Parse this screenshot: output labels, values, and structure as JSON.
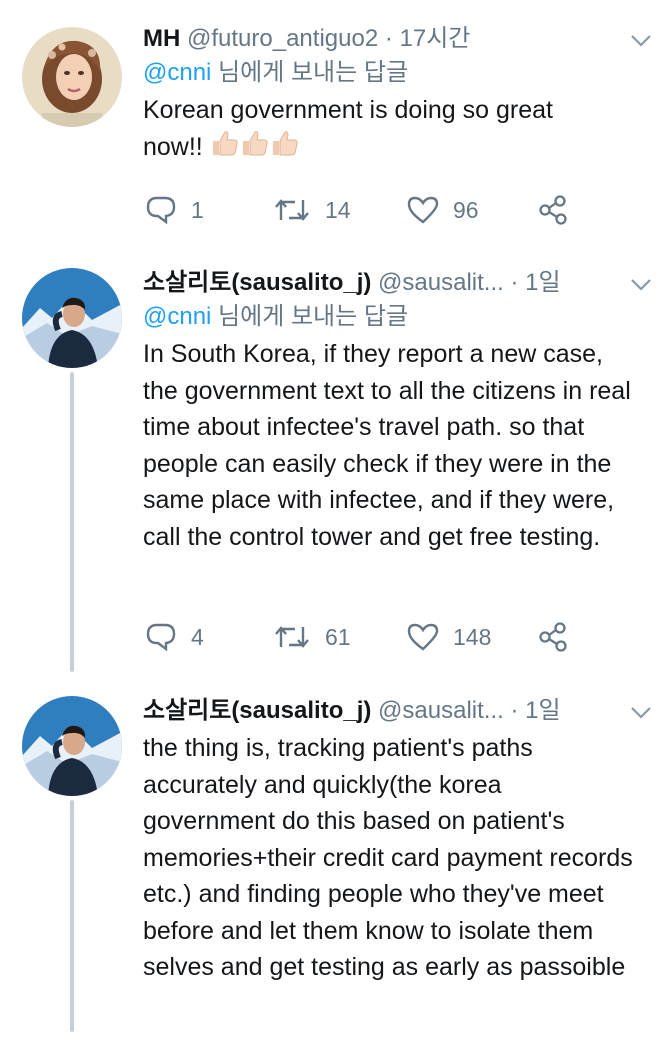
{
  "tweets": [
    {
      "name": "MH",
      "handle": "@futuro_antiguo2",
      "separator": "·",
      "time": "17시간",
      "reply_to_mention": "@cnni",
      "reply_to_suffix": " 님에게 보내는 답글",
      "text": "Korean government is doing so great now!!",
      "emoji": [
        "thumbs-up",
        "thumbs-up",
        "thumbs-up"
      ],
      "actions": {
        "reply": "1",
        "retweet": "14",
        "like": "96"
      }
    },
    {
      "name": "소살리토(sausalito_j)",
      "handle": "@sausalit...",
      "separator": "·",
      "time": "1일",
      "reply_to_mention": "@cnni",
      "reply_to_suffix": " 님에게 보내는 답글",
      "text": "In South Korea, if they report a new case, the government text to all the citizens in real time about infectee's travel path. so that people can easily check if they were in the same place with infectee, and if they were, call the control tower and get free testing.",
      "actions": {
        "reply": "4",
        "retweet": "61",
        "like": "148"
      }
    },
    {
      "name": "소살리토(sausalito_j)",
      "handle": "@sausalit...",
      "separator": "·",
      "time": "1일",
      "text": "the thing is, tracking patient's paths accurately and quickly(the korea government do this based on patient's memories+their credit card payment records etc.) and finding people who they've meet before and let them know to isolate them selves and get testing as early as passoible"
    }
  ],
  "colors": {
    "text": "#14171a",
    "secondary": "#657786",
    "link": "#1da1f2",
    "thread_line": "#c8d0d6"
  }
}
